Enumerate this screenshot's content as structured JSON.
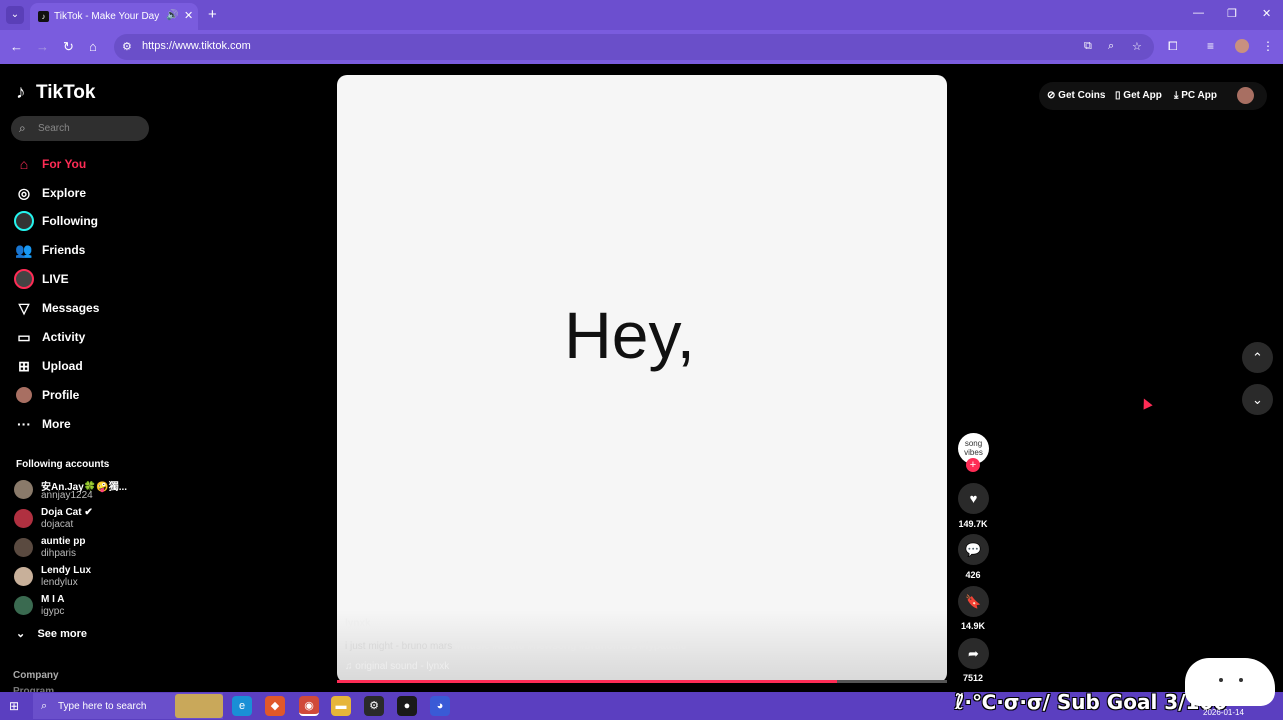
{
  "browser": {
    "tab_title": "TikTok - Make Your Day",
    "tab_favicon": "tiktok-icon",
    "url": "https://www.tiktok.com",
    "new_tab": "+",
    "tab_close": "✕",
    "minimize": "—",
    "maximize": "❐",
    "close": "✕"
  },
  "sidebar": {
    "logo": "TikTok",
    "search_placeholder": "Search",
    "nav": [
      {
        "label": "For You",
        "icon": "home-icon"
      },
      {
        "label": "Explore",
        "icon": "compass-icon"
      },
      {
        "label": "Following",
        "icon": "following-avatar-icon"
      },
      {
        "label": "Friends",
        "icon": "friends-icon"
      },
      {
        "label": "LIVE",
        "icon": "live-avatar-icon"
      },
      {
        "label": "Messages",
        "icon": "send-icon"
      },
      {
        "label": "Activity",
        "icon": "inbox-icon"
      },
      {
        "label": "Upload",
        "icon": "plus-square-icon"
      },
      {
        "label": "Profile",
        "icon": "profile-avatar-icon"
      },
      {
        "label": "More",
        "icon": "more-icon"
      }
    ],
    "following_title": "Following accounts",
    "accounts": [
      {
        "name": "安An.Jay🍀🤪獨...",
        "handle": "annjay1224",
        "color": "#8a7a6a"
      },
      {
        "name": "Doja Cat ✔",
        "handle": "dojacat",
        "color": "#b03040"
      },
      {
        "name": "auntie pp",
        "handle": "dihparis",
        "color": "#5a4a40"
      },
      {
        "name": "Lendy Lux",
        "handle": "lendylux",
        "color": "#c8b09a"
      },
      {
        "name": "M I A",
        "handle": "igypc",
        "color": "#3a6a50"
      }
    ],
    "see_more": "See more",
    "company": "Company",
    "program": "Program"
  },
  "video": {
    "overlay_text": "Hey,",
    "author": "lynxk",
    "caption_plain": "i just might - bruno mars ",
    "caption_tags": "#music #audio #newsong #brunomars #fypaudio",
    "sound": "♫  original sound - lynxk",
    "progress": 0.82
  },
  "actions": {
    "creator_avatar_text": "song vibes",
    "likes": "149.7K",
    "comments": "426",
    "saves": "14.9K",
    "shares": "7512"
  },
  "topbar": {
    "get_coins": "Get Coins",
    "get_app": "Get App",
    "pc_app": "PC App"
  },
  "taskbar": {
    "search_placeholder": "Type here to search",
    "overlay": "ℓ̃·℃·σ·σ/ Sub Goal 3/100",
    "date": "2026-01-14"
  }
}
